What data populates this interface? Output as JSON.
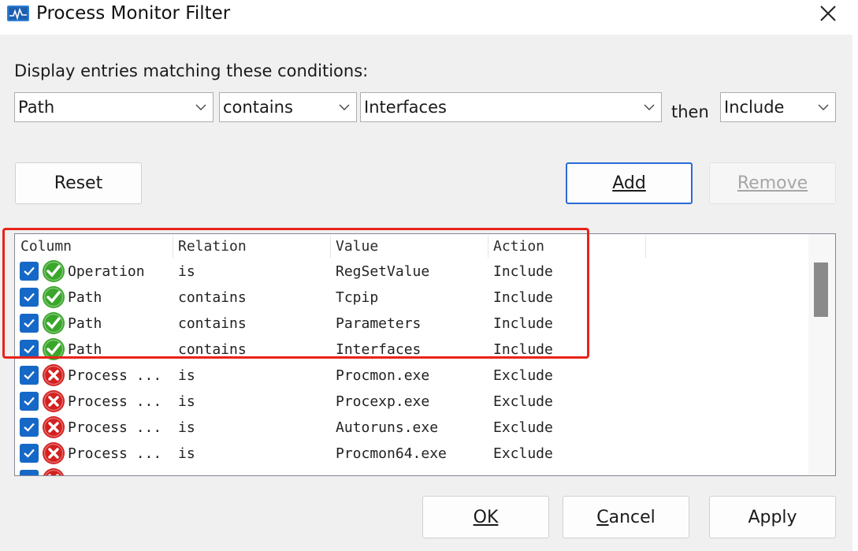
{
  "window": {
    "title": "Process Monitor Filter"
  },
  "condition": {
    "label": "Display entries matching these conditions:",
    "column_value": "Path",
    "relation_value": "contains",
    "value_value": "Interfaces",
    "then_label": "then",
    "action_value": "Include"
  },
  "buttons": {
    "reset": "Reset",
    "add": "Add",
    "remove": "Remove",
    "ok": "OK",
    "cancel": "Cancel",
    "apply": "Apply"
  },
  "table": {
    "headers": [
      "Column",
      "Relation",
      "Value",
      "Action"
    ],
    "rows": [
      {
        "column": "Operation",
        "relation": "is",
        "value": "RegSetValue",
        "action": "Include",
        "checked": true,
        "status": "include-icon"
      },
      {
        "column": "Path",
        "relation": "contains",
        "value": "Tcpip",
        "action": "Include",
        "checked": true,
        "status": "include-icon"
      },
      {
        "column": "Path",
        "relation": "contains",
        "value": "Parameters",
        "action": "Include",
        "checked": true,
        "status": "include-icon"
      },
      {
        "column": "Path",
        "relation": "contains",
        "value": "Interfaces",
        "action": "Include",
        "checked": true,
        "status": "include-icon"
      },
      {
        "column": "Process ...",
        "relation": "is",
        "value": "Procmon.exe",
        "action": "Exclude",
        "checked": true,
        "status": "exclude-icon"
      },
      {
        "column": "Process ...",
        "relation": "is",
        "value": "Procexp.exe",
        "action": "Exclude",
        "checked": true,
        "status": "exclude-icon"
      },
      {
        "column": "Process ...",
        "relation": "is",
        "value": "Autoruns.exe",
        "action": "Exclude",
        "checked": true,
        "status": "exclude-icon"
      },
      {
        "column": "Process ...",
        "relation": "is",
        "value": "Procmon64.exe",
        "action": "Exclude",
        "checked": true,
        "status": "exclude-icon"
      }
    ]
  },
  "colors": {
    "highlight": "#e8231b",
    "checkbox": "#1668c7",
    "include": "#3aa62b",
    "exclude": "#d42020",
    "default_button_border": "#2a6bd6"
  }
}
